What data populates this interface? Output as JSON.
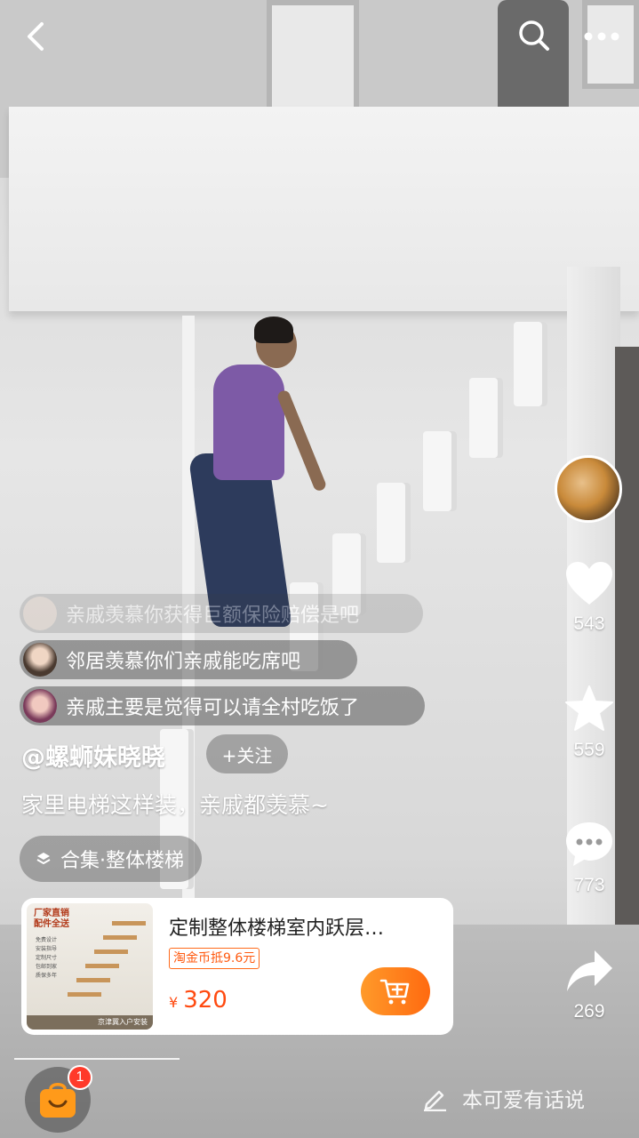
{
  "topbar": {
    "back_icon": "chevron-left-icon",
    "search_icon": "search-icon",
    "more_icon": "more-dots-icon"
  },
  "actions": {
    "likes": "543",
    "favorites": "559",
    "comments": "773",
    "shares": "269"
  },
  "danmaku": [
    {
      "text": "亲戚羡慕你获得巨额保险赔偿是吧"
    },
    {
      "text": "邻居羡慕你们亲戚能吃席吧"
    },
    {
      "text": "亲戚主要是觉得可以请全村吃饭了"
    }
  ],
  "author": {
    "handle": "@螺蛳妹晓晓",
    "follow_label": "+关注"
  },
  "caption": "家里电梯这样装，亲戚都羡慕~",
  "collection": {
    "label": "合集·整体楼梯"
  },
  "product": {
    "title": "定制整体楼梯室内跃层…",
    "coupon": "淘金币抵9.6元",
    "currency": "¥",
    "price": "320",
    "thumb_badge_line1": "厂家直销",
    "thumb_badge_line2": "配件全送",
    "thumb_bullets": [
      "免费设计",
      "安装指导",
      "定制尺寸",
      "包邮到家",
      "质保多年"
    ],
    "thumb_footer": "京津冀入户安装"
  },
  "bottom": {
    "cart_badge": "1",
    "comment_prompt": "本可爱有话说"
  },
  "colors": {
    "accent_orange": "#ff6a10",
    "price_red": "#ff4a10",
    "badge_red": "#ff3a2a"
  }
}
